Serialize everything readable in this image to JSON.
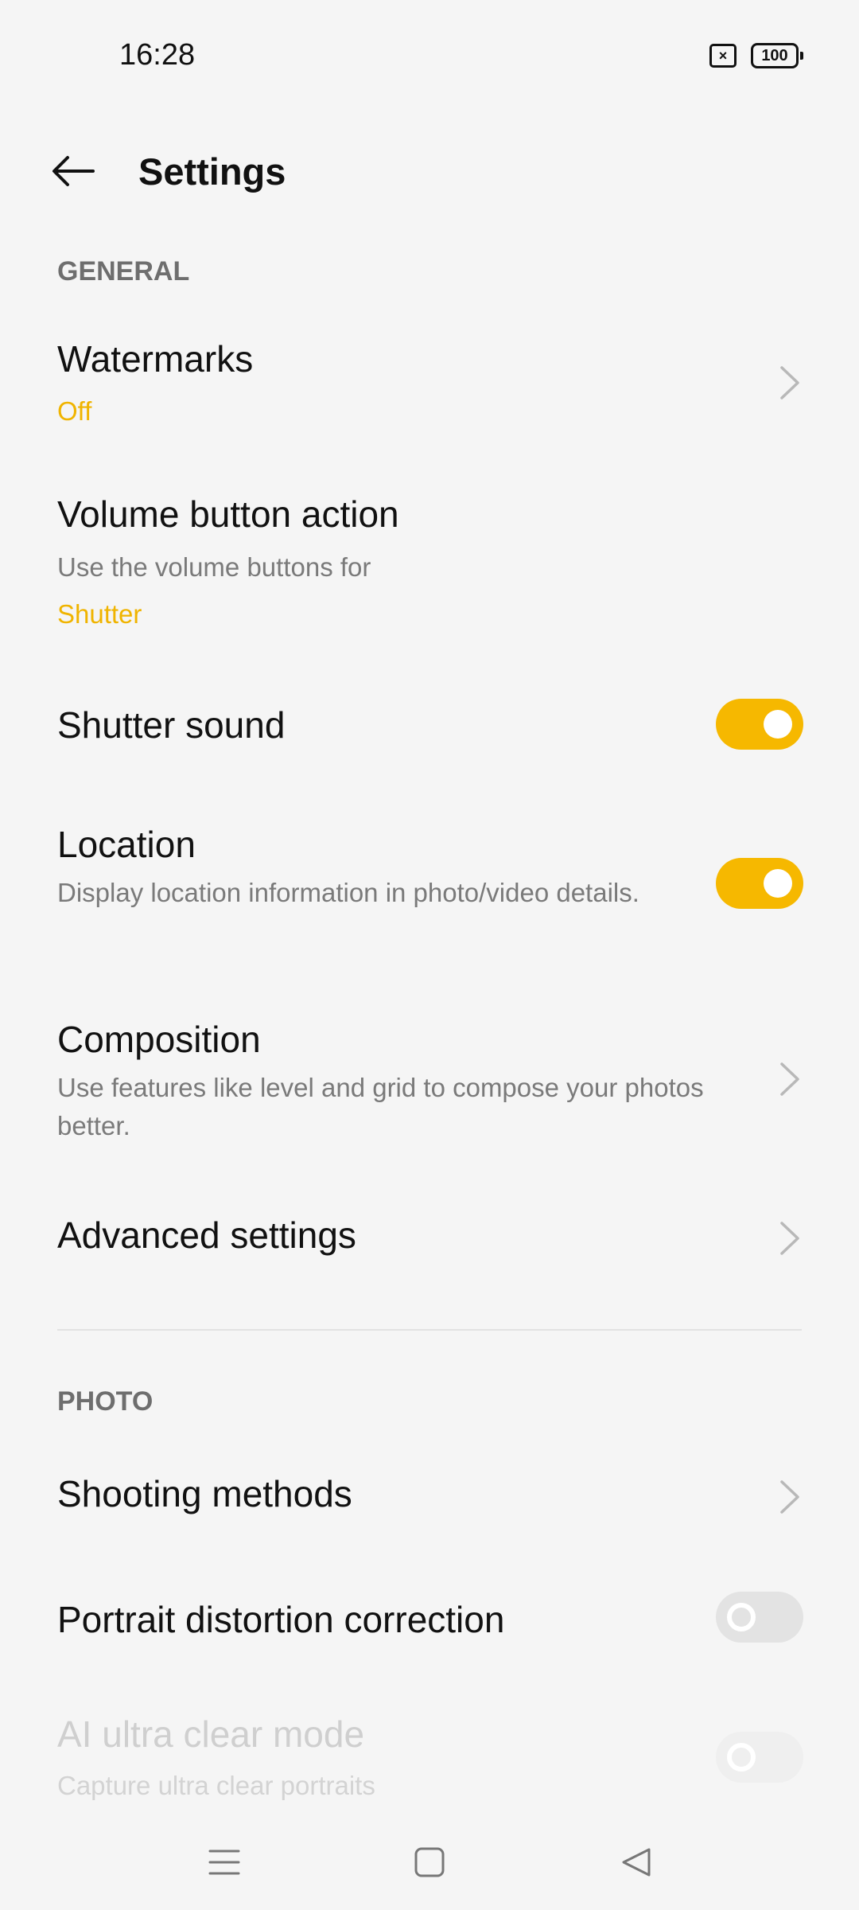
{
  "status_bar": {
    "time": "16:28",
    "sim_symbol": "×",
    "battery_level": "100"
  },
  "header": {
    "title": "Settings"
  },
  "sections": {
    "general": {
      "label": "GENERAL",
      "watermarks": {
        "title": "Watermarks",
        "value": "Off"
      },
      "volume_button": {
        "title": "Volume button action",
        "subtitle": "Use the volume buttons for",
        "value": "Shutter"
      },
      "shutter_sound": {
        "title": "Shutter sound",
        "enabled": true
      },
      "location": {
        "title": "Location",
        "subtitle": "Display location information in photo/video details.",
        "enabled": true
      },
      "composition": {
        "title": "Composition",
        "subtitle": "Use features like level and grid to compose your photos better."
      },
      "advanced": {
        "title": "Advanced settings"
      }
    },
    "photo": {
      "label": "PHOTO",
      "shooting_methods": {
        "title": "Shooting methods"
      },
      "portrait_distortion": {
        "title": "Portrait distortion correction",
        "enabled": false
      },
      "ai_ultra_clear": {
        "title": "AI ultra clear mode",
        "subtitle": "Capture ultra clear portraits",
        "enabled": false,
        "disabled": true
      }
    }
  },
  "colors": {
    "accent": "#f6b800",
    "value_text": "#f0b400",
    "background": "#f5f5f5"
  },
  "icons": {
    "back": "arrow-left-icon",
    "chevron": "chevron-right-icon",
    "nav_menu": "menu-icon",
    "nav_home": "square-home-icon",
    "nav_back": "triangle-back-icon"
  }
}
